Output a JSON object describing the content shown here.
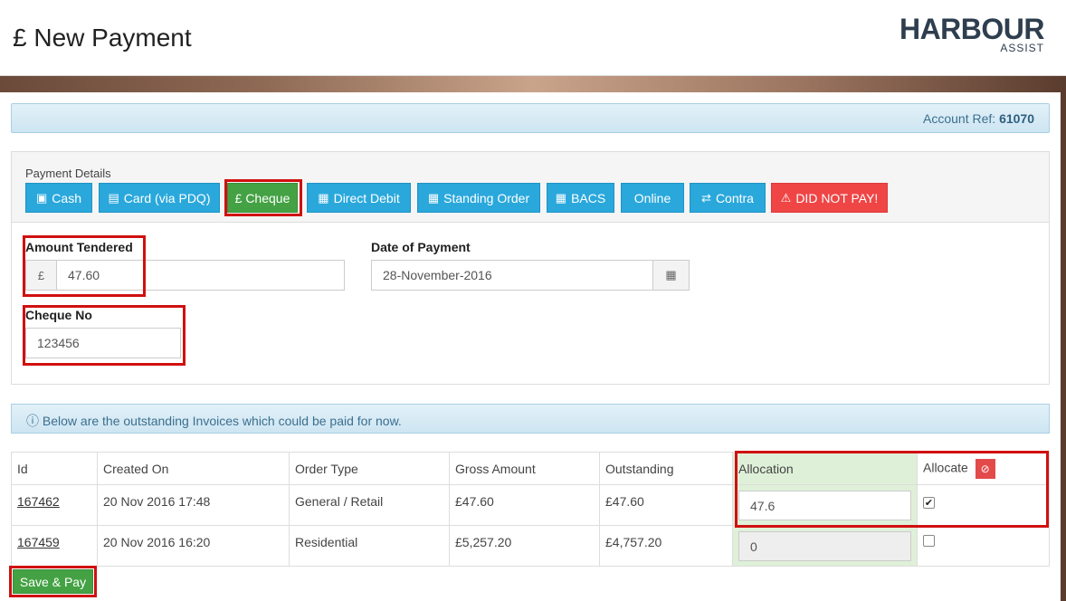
{
  "header": {
    "title": "£ New Payment",
    "logo_main": "HARBOUR",
    "logo_sub": "ASSIST"
  },
  "account": {
    "label": "Account Ref:",
    "value": "61070"
  },
  "payment": {
    "details_label": "Payment Details",
    "methods": [
      {
        "label": "Cash",
        "icon": "money-icon"
      },
      {
        "label": "Card (via PDQ)",
        "icon": "credit-card-icon"
      },
      {
        "label": "£ Cheque",
        "icon": "",
        "active": true
      },
      {
        "label": "Direct Debit",
        "icon": "calendar-icon"
      },
      {
        "label": "Standing Order",
        "icon": "calendar-icon"
      },
      {
        "label": "BACS",
        "icon": "calendar-icon"
      },
      {
        "label": "Online",
        "icon": ""
      },
      {
        "label": "Contra",
        "icon": "exchange-icon"
      },
      {
        "label": "DID NOT PAY!",
        "icon": "warning-icon"
      }
    ],
    "amount_label": "Amount Tendered",
    "currency_symbol": "£",
    "amount_value": "47.60",
    "date_label": "Date of Payment",
    "date_value": "28-November-2016",
    "cheque_label": "Cheque No",
    "cheque_value": "123456"
  },
  "info_text": "Below are the outstanding Invoices which could be paid for now.",
  "table": {
    "headers": [
      "Id",
      "Created On",
      "Order Type",
      "Gross Amount",
      "Outstanding",
      "Allocation",
      "Allocate"
    ],
    "rows": [
      {
        "id": "167462",
        "created": "20 Nov 2016 17:48",
        "type": "General / Retail",
        "gross": "£47.60",
        "outstanding": "£47.60",
        "allocation": "47.6",
        "checked": true
      },
      {
        "id": "167459",
        "created": "20 Nov 2016 16:20",
        "type": "Residential",
        "gross": "£5,257.20",
        "outstanding": "£4,757.20",
        "allocation": "0",
        "checked": false
      }
    ]
  },
  "save_label": "Save & Pay",
  "colors": {
    "primary": "#2aa8dc",
    "success": "#44a244",
    "danger": "#ef4545",
    "highlight": "#d01010"
  }
}
